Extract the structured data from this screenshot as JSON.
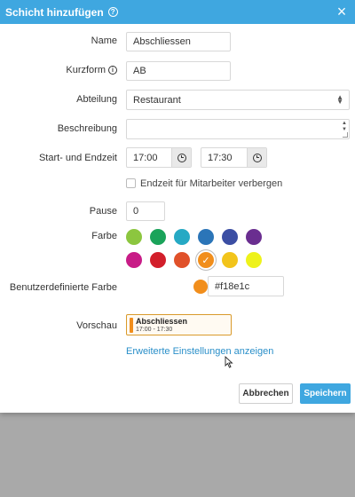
{
  "modal": {
    "title": "Schicht hinzufügen",
    "close_symbol": "×"
  },
  "form": {
    "name_label": "Name",
    "name_value": "Abschliessen",
    "short_label": "Kurzform",
    "short_value": "AB",
    "department_label": "Abteilung",
    "department_value": "Restaurant",
    "description_label": "Beschreibung",
    "description_value": "",
    "time_label": "Start- und Endzeit",
    "start_time": "17:00",
    "end_time": "17:30",
    "hide_end_label": "Endzeit für Mitarbeiter verbergen",
    "pause_label": "Pause",
    "pause_value": "0",
    "color_label": "Farbe",
    "custom_color_label": "Benutzerdefinierte Farbe",
    "custom_color_value": "#f18e1c",
    "preview_label": "Vorschau"
  },
  "colors": {
    "row1": [
      "#8cc63f",
      "#1aa35a",
      "#26a9c4",
      "#2b75b8",
      "#3b4ea3",
      "#6a2e90"
    ],
    "row2": [
      "#c81c87",
      "#d21f2b",
      "#e0512a",
      "#f18e1c",
      "#f2c41b",
      "#eef21b"
    ],
    "selected": "#f18e1c",
    "accent": "#3fa7e0"
  },
  "preview": {
    "title": "Abschliessen",
    "time": "17:00 - 17:30"
  },
  "advanced_link": "Erweiterte Einstellungen anzeigen",
  "buttons": {
    "cancel": "Abbrechen",
    "save": "Speichern"
  }
}
